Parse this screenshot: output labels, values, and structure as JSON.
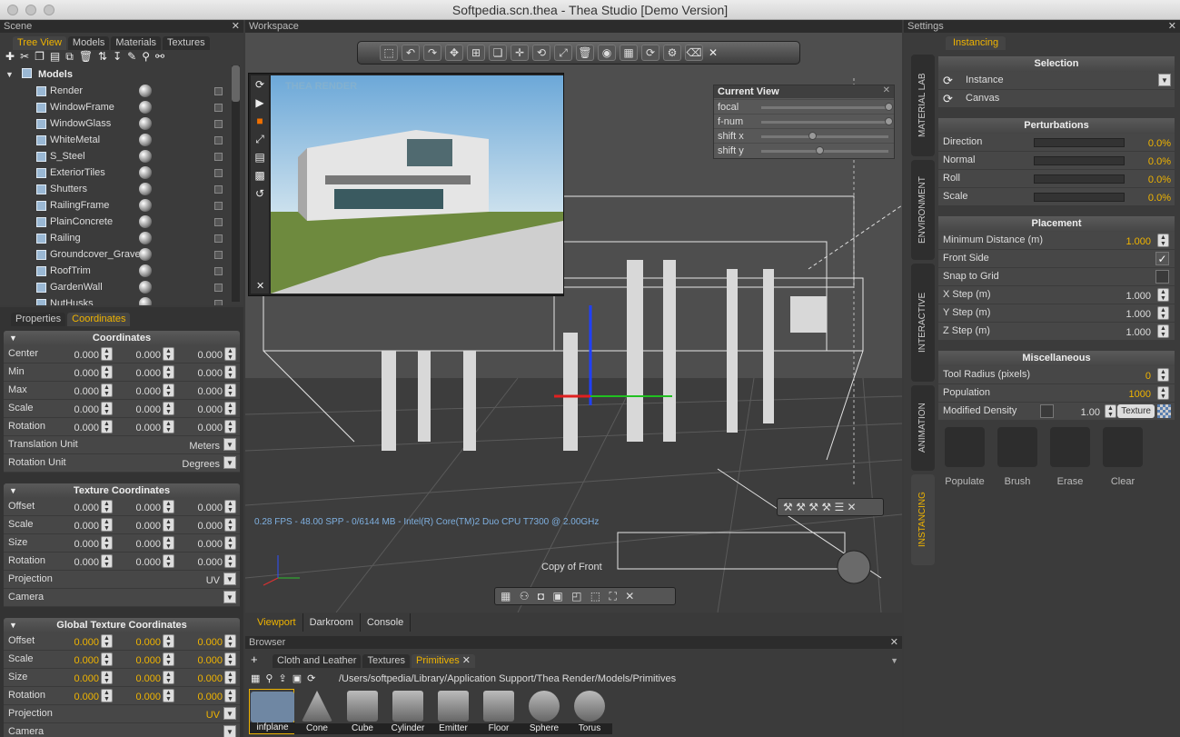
{
  "window": {
    "title": "Softpedia.scn.thea - Thea Studio [Demo Version]"
  },
  "scene": {
    "panel_title": "Scene",
    "tabs": [
      "Tree View",
      "Models",
      "Materials",
      "Textures"
    ],
    "active_tab": "Tree View",
    "root_label": "Models",
    "items": [
      "Render",
      "WindowFrame",
      "WindowGlass",
      "WhiteMetal",
      "S_Steel",
      "ExteriorTiles",
      "Shutters",
      "RailingFrame",
      "PlainConcrete",
      "Railing",
      "Groundcover_Grave",
      "RoofTrim",
      "GardenWall",
      "NutHusks"
    ]
  },
  "props": {
    "tabs": [
      "Properties",
      "Coordinates"
    ],
    "active_tab": "Coordinates",
    "coordinates": {
      "title": "Coordinates",
      "rows": [
        {
          "label": "Center",
          "v": [
            "0.000",
            "0.000",
            "0.000"
          ]
        },
        {
          "label": "Min",
          "v": [
            "0.000",
            "0.000",
            "0.000"
          ]
        },
        {
          "label": "Max",
          "v": [
            "0.000",
            "0.000",
            "0.000"
          ]
        },
        {
          "label": "Scale",
          "v": [
            "0.000",
            "0.000",
            "0.000"
          ]
        },
        {
          "label": "Rotation",
          "v": [
            "0.000",
            "0.000",
            "0.000"
          ]
        }
      ],
      "translation_unit_label": "Translation Unit",
      "translation_unit_value": "Meters",
      "rotation_unit_label": "Rotation Unit",
      "rotation_unit_value": "Degrees"
    },
    "texture_coordinates": {
      "title": "Texture Coordinates",
      "rows": [
        {
          "label": "Offset",
          "v": [
            "0.000",
            "0.000",
            "0.000"
          ]
        },
        {
          "label": "Scale",
          "v": [
            "0.000",
            "0.000",
            "0.000"
          ]
        },
        {
          "label": "Size",
          "v": [
            "0.000",
            "0.000",
            "0.000"
          ]
        },
        {
          "label": "Rotation",
          "v": [
            "0.000",
            "0.000",
            "0.000"
          ]
        }
      ],
      "projection_label": "Projection",
      "projection_value": "UV",
      "camera_label": "Camera"
    },
    "global_texture_coordinates": {
      "title": "Global Texture Coordinates",
      "rows": [
        {
          "label": "Offset",
          "v": [
            "0.000",
            "0.000",
            "0.000"
          ]
        },
        {
          "label": "Scale",
          "v": [
            "0.000",
            "0.000",
            "0.000"
          ]
        },
        {
          "label": "Size",
          "v": [
            "0.000",
            "0.000",
            "0.000"
          ]
        },
        {
          "label": "Rotation",
          "v": [
            "0.000",
            "0.000",
            "0.000"
          ]
        }
      ],
      "projection_label": "Projection",
      "projection_value": "UV",
      "camera_label": "Camera"
    }
  },
  "workspace": {
    "panel_title": "Workspace",
    "current_view": {
      "title": "Current View",
      "rows": [
        "focal",
        "f-num",
        "shift x",
        "shift y"
      ]
    },
    "status": "0.28 FPS - 48.00 SPP - 0/6144 MB - Intel(R) Core(TM)2 Duo CPU     T7300  @ 2.00GHz",
    "camera_label": "Copy of Front",
    "watermark": "THEA RENDER",
    "view_tabs": [
      "Viewport",
      "Darkroom",
      "Console"
    ],
    "active_view_tab": "Viewport"
  },
  "browser": {
    "panel_title": "Browser",
    "tabs": [
      "Cloth and Leather",
      "Textures",
      "Primitives"
    ],
    "active_tab": "Primitives",
    "path": "/Users/softpedia/Library/Application Support/Thea Render/Models/Primitives",
    "items": [
      "infplane",
      "Cone",
      "Cube",
      "Cylinder",
      "Emitter",
      "Floor",
      "Sphere",
      "Torus"
    ]
  },
  "settings": {
    "panel_title": "Settings",
    "tab": "Instancing",
    "side_tabs": [
      "MATERIAL LAB",
      "ENVIRONMENT",
      "INTERACTIVE",
      "ANIMATION",
      "INSTANCING"
    ],
    "selection": {
      "title": "Selection",
      "items": [
        "Instance",
        "Canvas"
      ]
    },
    "perturbations": {
      "title": "Perturbations",
      "rows": [
        {
          "label": "Direction",
          "value": "0.0%"
        },
        {
          "label": "Normal",
          "value": "0.0%"
        },
        {
          "label": "Roll",
          "value": "0.0%"
        },
        {
          "label": "Scale",
          "value": "0.0%"
        }
      ]
    },
    "placement": {
      "title": "Placement",
      "min_distance_label": "Minimum Distance (m)",
      "min_distance_value": "1.000",
      "front_side_label": "Front Side",
      "snap_label": "Snap to Grid",
      "x_step_label": "X Step (m)",
      "x_step_value": "1.000",
      "y_step_label": "Y Step (m)",
      "y_step_value": "1.000",
      "z_step_label": "Z Step (m)",
      "z_step_value": "1.000"
    },
    "misc": {
      "title": "Miscellaneous",
      "tool_radius_label": "Tool Radius (pixels)",
      "tool_radius_value": "0",
      "population_label": "Population",
      "population_value": "1000",
      "modified_density_label": "Modified Density",
      "modified_density_value": "1.00",
      "texture_button": "Texture"
    },
    "tools": [
      "Populate",
      "Brush",
      "Erase",
      "Clear"
    ]
  },
  "colors": {
    "accent": "#f0b400",
    "panel": "#3b3b3b",
    "header": "#2c2c2c"
  }
}
